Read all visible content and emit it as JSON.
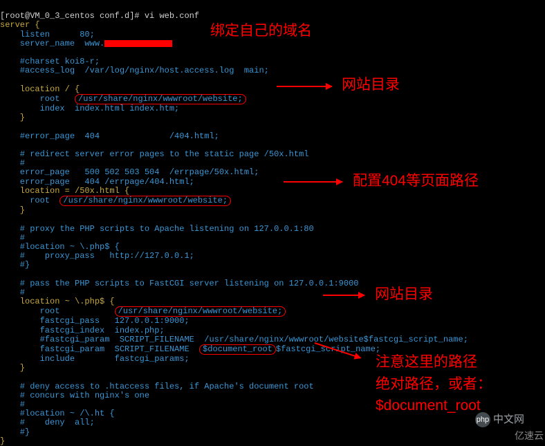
{
  "prompt": {
    "user_host": "[root@VM_0_3_centos conf.d]#",
    "command": "vi web.conf"
  },
  "config": {
    "l1": "server {",
    "l2": "    listen      80;",
    "l3": "    server_name  www.",
    "l4": "",
    "l5": "    #charset koi8-r;",
    "l6": "    #access_log  /var/log/nginx/host.access.log  main;",
    "l7": "",
    "l8": "    location / {",
    "l9a": "        root   ",
    "l9b": "/usr/share/nginx/wwwroot/website;",
    "l10": "        index  index.html index.htm;",
    "l11": "    }",
    "l12": "",
    "l13": "    #error_page  404              /404.html;",
    "l14": "",
    "l15": "    # redirect server error pages to the static page /50x.html",
    "l16": "    #",
    "l17": "    error_page   500 502 503 504  /errpage/50x.html;",
    "l18": "    error_page   404 /errpage/404.html;",
    "l19": "    location = /50x.html {",
    "l20a": "      root  ",
    "l20b": "/usr/share/nginx/wwwroot/website;",
    "l21": "    }",
    "l22": "",
    "l23": "    # proxy the PHP scripts to Apache listening on 127.0.0.1:80",
    "l24": "    #",
    "l25": "    #location ~ \\.php$ {",
    "l26": "    #    proxy_pass   http://127.0.0.1;",
    "l27": "    #}",
    "l28": "",
    "l29": "    # pass the PHP scripts to FastCGI server listening on 127.0.0.1:9000",
    "l30": "    #",
    "l31": "    location ~ \\.php$ {",
    "l32a": "        root           ",
    "l32b": "/usr/share/nginx/wwwroot/website;",
    "l33": "        fastcgi_pass   127.0.0.1:9000;",
    "l34": "        fastcgi_index  index.php;",
    "l35": "        #fastcgi_param  SCRIPT_FILENAME  /usr/share/nginx/wwwroot/website$fastcgi_script_name;",
    "l36a": "        fastcgi_param  SCRIPT_FILENAME  ",
    "l36b": "$document_root",
    "l36c": "$fastcgi_script_name;",
    "l37": "        include        fastcgi_params;",
    "l38": "    }",
    "l39": "",
    "l40": "    # deny access to .htaccess files, if Apache's document root",
    "l41": "    # concurs with nginx's one",
    "l42": "    #",
    "l43": "    #location ~ /\\.ht {",
    "l44": "    #    deny  all;",
    "l45": "    #}",
    "l46": "}"
  },
  "annotations": {
    "a1": "绑定自己的域名",
    "a2": "网站目录",
    "a3": "配置404等页面路径",
    "a4": "网站目录",
    "a5_line1": "注意这里的路径",
    "a5_line2": "绝对路径，或者：",
    "a5_line3": "$document_root"
  },
  "watermarks": {
    "w1": "中文网",
    "w1_prefix": "php",
    "w2": "亿速云"
  }
}
